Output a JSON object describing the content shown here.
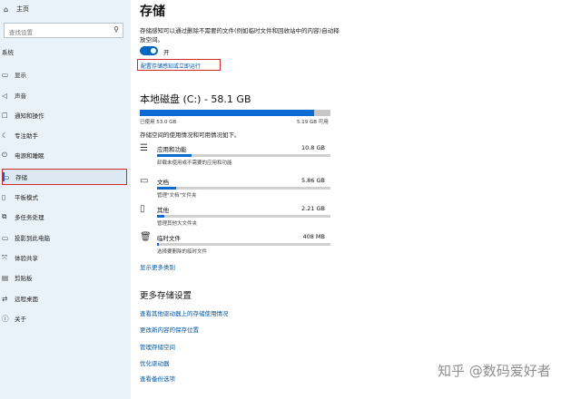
{
  "sidebar": {
    "home_icon": "home-icon",
    "home_label": "主页",
    "search_placeholder": "查找设置",
    "section_label": "系统",
    "items": [
      {
        "label": "显示",
        "icon": "display-icon",
        "glyph": "▭"
      },
      {
        "label": "声音",
        "icon": "sound-icon",
        "glyph": "◁"
      },
      {
        "label": "通知和操作",
        "icon": "notification-icon",
        "glyph": "☐"
      },
      {
        "label": "专注助手",
        "icon": "focus-assist-icon",
        "glyph": "☾"
      },
      {
        "label": "电源和睡眠",
        "icon": "power-icon",
        "glyph": "⏻"
      },
      {
        "label": "存储",
        "icon": "storage-icon",
        "glyph": "▭"
      },
      {
        "label": "平板模式",
        "icon": "tablet-icon",
        "glyph": "▯"
      },
      {
        "label": "多任务处理",
        "icon": "multitasking-icon",
        "glyph": "⧉"
      },
      {
        "label": "投影到此电脑",
        "icon": "project-icon",
        "glyph": "▭"
      },
      {
        "label": "体验共享",
        "icon": "share-icon",
        "glyph": "⤧"
      },
      {
        "label": "剪贴板",
        "icon": "clipboard-icon",
        "glyph": "▤"
      },
      {
        "label": "远程桌面",
        "icon": "remote-desktop-icon",
        "glyph": "⇄"
      },
      {
        "label": "关于",
        "icon": "about-icon",
        "glyph": "ⓘ"
      }
    ],
    "active_index": 5
  },
  "main": {
    "title": "存储",
    "description": "存储感知可以通过删除不需要的文件(例如临时文件和回收站中的内容)自动释放空间。",
    "toggle_state": "开",
    "configure_link": "配置存储感知或立即运行",
    "disk_title": "本地磁盘 (C:) - 58.1 GB",
    "used_label": "已使用 53.0 GB",
    "available_label": "5.19 GB 可用",
    "usage_fraction": 0.912,
    "usage_desc": "存储空间的使用情况和可用情况如下。",
    "categories": [
      {
        "name": "应用和功能",
        "size": "10.8 GB",
        "sub": "卸载未使用或不需要的应用和功能",
        "icon": "apps-icon",
        "glyph": "☰",
        "fraction": 0.2
      },
      {
        "name": "文档",
        "size": "5.86 GB",
        "sub": "管理\"文档\"文件夹",
        "icon": "documents-icon",
        "glyph": "▭",
        "fraction": 0.11
      },
      {
        "name": "其他",
        "size": "2.21 GB",
        "sub": "管理其他大文件夹",
        "icon": "other-icon",
        "glyph": "▯",
        "fraction": 0.04
      },
      {
        "name": "临时文件",
        "size": "408 MB",
        "sub": "选择要删除的临时文件",
        "icon": "trash-icon",
        "glyph": "🗑",
        "fraction": 0.008
      }
    ],
    "show_more": "显示更多类别",
    "more_title": "更多存储设置",
    "more_links": [
      "查看其他驱动器上的存储使用情况",
      "更改新内容的保存位置",
      "管理存储空间",
      "优化驱动器",
      "查看备份选项"
    ]
  },
  "watermark": "知乎 @数码爱好者",
  "colors": {
    "accent": "#0a6ad1",
    "highlight": "#d02a2a",
    "sidebar_bg": "#e8f2f8"
  }
}
